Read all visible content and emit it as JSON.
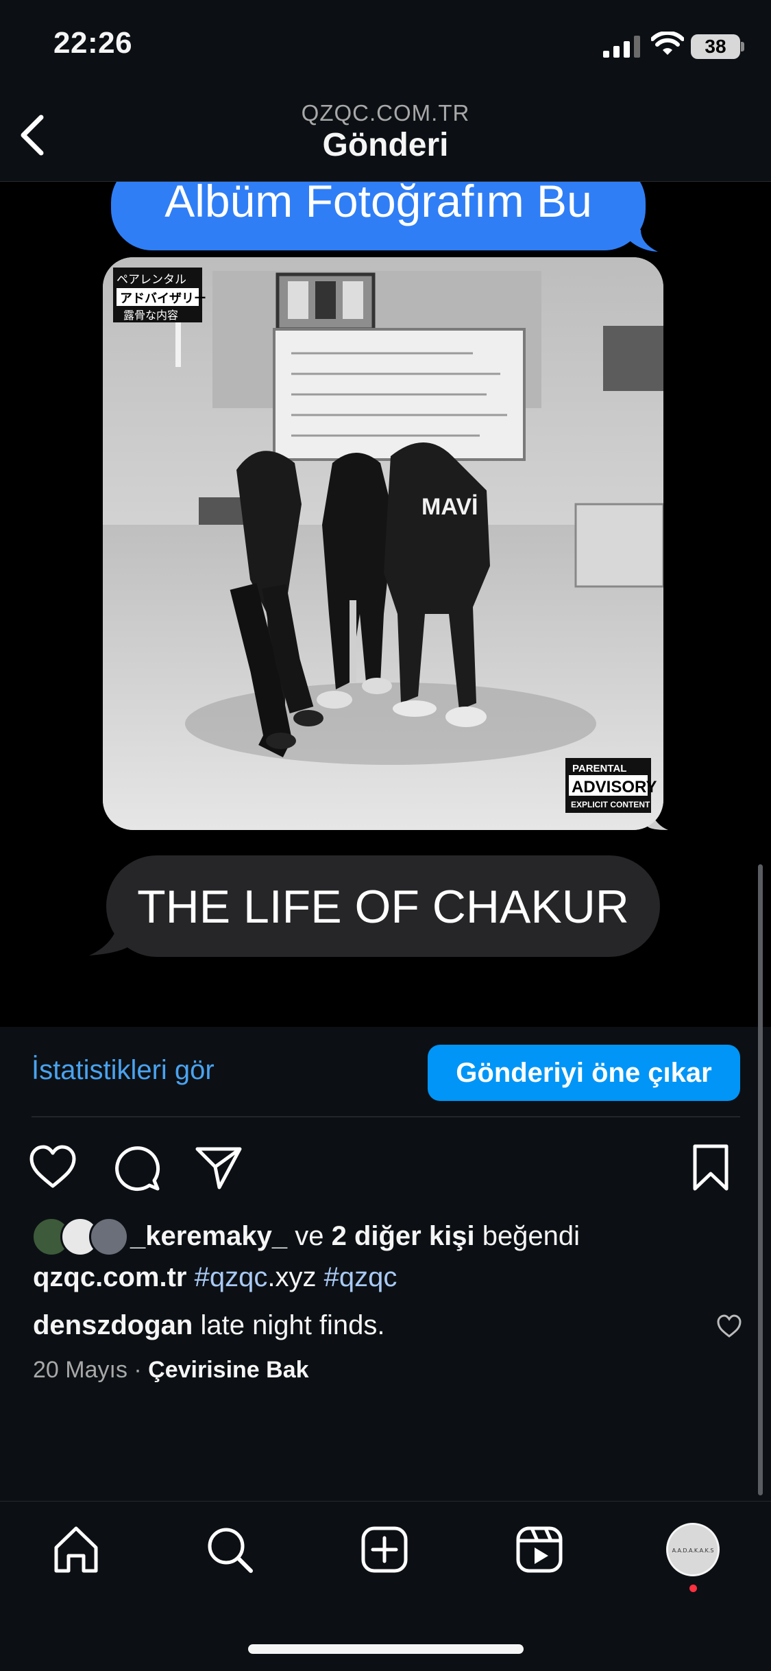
{
  "status_bar": {
    "time": "22:26",
    "battery": "38"
  },
  "header": {
    "subtitle": "QZQC.COM.TR",
    "title": "Gönderi"
  },
  "post_image": {
    "top_bubble_text": "Albüm Fotoğrafım Bu",
    "bottom_bubble_text": "THE LIFE OF CHAKUR",
    "advisory_jp_line1": "ペアレンタル",
    "advisory_jp_line2": "アドバイザリー",
    "advisory_jp_line3": "露骨な内容",
    "hoodie_text": "MAVİ",
    "advisory_en_line1": "PARENTAL",
    "advisory_en_line2": "ADVISORY",
    "advisory_en_line3": "EXPLICIT CONTENT"
  },
  "actions": {
    "stats_label": "İstatistikleri gör",
    "promote_label": "Gönderiyi öne çıkar"
  },
  "likes": {
    "user": "_keremaky_",
    "connector": " ve ",
    "others": "2 diğer kişi",
    "suffix": " beğendi"
  },
  "caption": {
    "account": "qzqc.com.tr",
    "tag1": "#qzqc",
    "tag1_suffix": ".xyz",
    "tag2": "#qzqc"
  },
  "comment": {
    "user": "denszdogan",
    "text": " late night finds."
  },
  "meta": {
    "date": "20 Mayıs",
    "separator": " · ",
    "translate": "Çevirisine Bak"
  },
  "profile_avatar_text": "A.A.D.A.K.A.K.S"
}
